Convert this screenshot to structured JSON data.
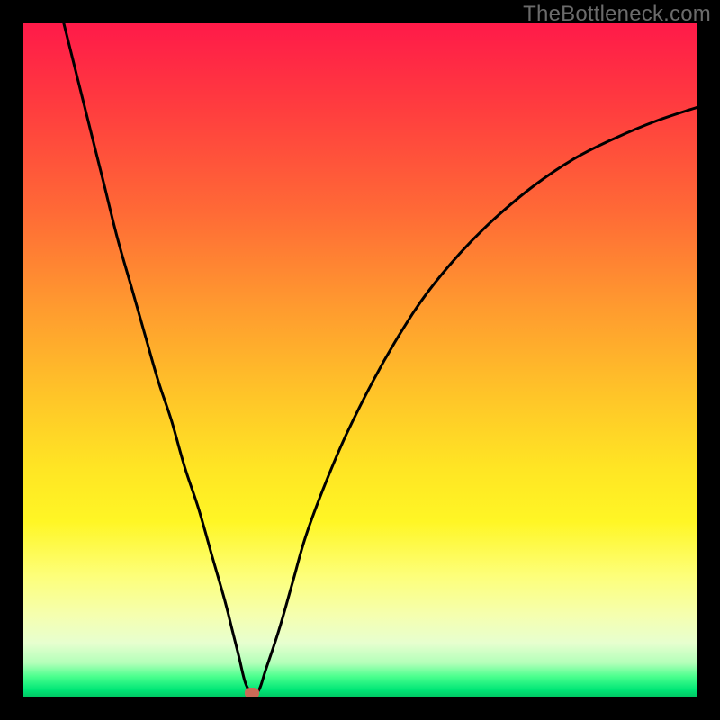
{
  "watermark": "TheBottleneck.com",
  "chart_data": {
    "type": "line",
    "title": "",
    "xlabel": "",
    "ylabel": "",
    "xlim": [
      0,
      100
    ],
    "ylim": [
      0,
      100
    ],
    "grid": false,
    "series": [
      {
        "name": "curve",
        "x": [
          6,
          8,
          10,
          12,
          14,
          16,
          18,
          20,
          22,
          24,
          26,
          28,
          30,
          31,
          32,
          33,
          34,
          35,
          36,
          38,
          40,
          42,
          45,
          48,
          52,
          56,
          60,
          65,
          70,
          76,
          82,
          88,
          94,
          100
        ],
        "y": [
          100,
          92,
          84,
          76,
          68,
          61,
          54,
          47,
          41,
          34,
          28,
          21,
          14,
          10,
          6,
          2,
          0.5,
          1,
          4,
          10,
          17,
          24,
          32,
          39,
          47,
          54,
          60,
          66,
          71,
          76,
          80,
          83,
          85.5,
          87.5
        ]
      }
    ],
    "marker": {
      "x": 34,
      "y": 0.5
    },
    "background_gradient": {
      "direction": "vertical",
      "stops": [
        {
          "pos": 0.0,
          "color": "#ff1a49"
        },
        {
          "pos": 0.28,
          "color": "#ff6a36"
        },
        {
          "pos": 0.56,
          "color": "#ffc728"
        },
        {
          "pos": 0.82,
          "color": "#fdff79"
        },
        {
          "pos": 0.95,
          "color": "#b3ffb9"
        },
        {
          "pos": 1.0,
          "color": "#00c864"
        }
      ]
    }
  },
  "colors": {
    "curve": "#000000",
    "marker": "#c96a57",
    "frame": "#000000",
    "watermark": "#6b6b6b"
  }
}
